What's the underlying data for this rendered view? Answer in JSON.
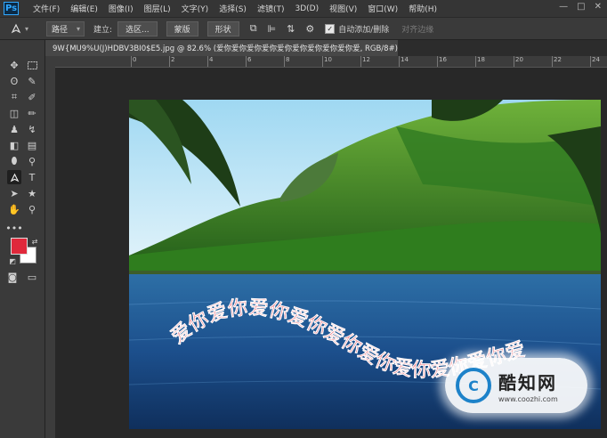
{
  "app": {
    "logo": "Ps"
  },
  "menu": [
    "文件(F)",
    "编辑(E)",
    "图像(I)",
    "图层(L)",
    "文字(Y)",
    "选择(S)",
    "滤镜(T)",
    "3D(D)",
    "视图(V)",
    "窗口(W)",
    "帮助(H)"
  ],
  "window_controls": [
    "—",
    "□",
    "✕"
  ],
  "options": {
    "mode_value": "路径",
    "make_label": "建立:",
    "selection_btn": "选区...",
    "mask_btn": "蒙版",
    "shape_btn": "形状",
    "auto_add_label": "自动添加/删除",
    "align_edges_label": "对齐边缘"
  },
  "document": {
    "tab_title": "9W{MU9%U(J)HDBV3BI0$E5.jpg @ 82.6% (爱你爱你爱你爱你爱你爱你爱你爱你爱你爱, RGB/8#) *",
    "close": "✕"
  },
  "ruler": {
    "h_ticks": [
      "0",
      "2",
      "4",
      "6",
      "8",
      "10",
      "12",
      "14",
      "16",
      "18",
      "20",
      "22",
      "24"
    ]
  },
  "canvas": {
    "warped_text": "爱你爱你爱你爱你爱你爱你爱你爱你爱你爱",
    "text_color": "#e0293b"
  },
  "watermark": {
    "icon_letter": "C",
    "title": "酷知网",
    "url": "www.coozhi.com"
  },
  "colors": {
    "foreground": "#e0293b",
    "background": "#ffffff"
  }
}
